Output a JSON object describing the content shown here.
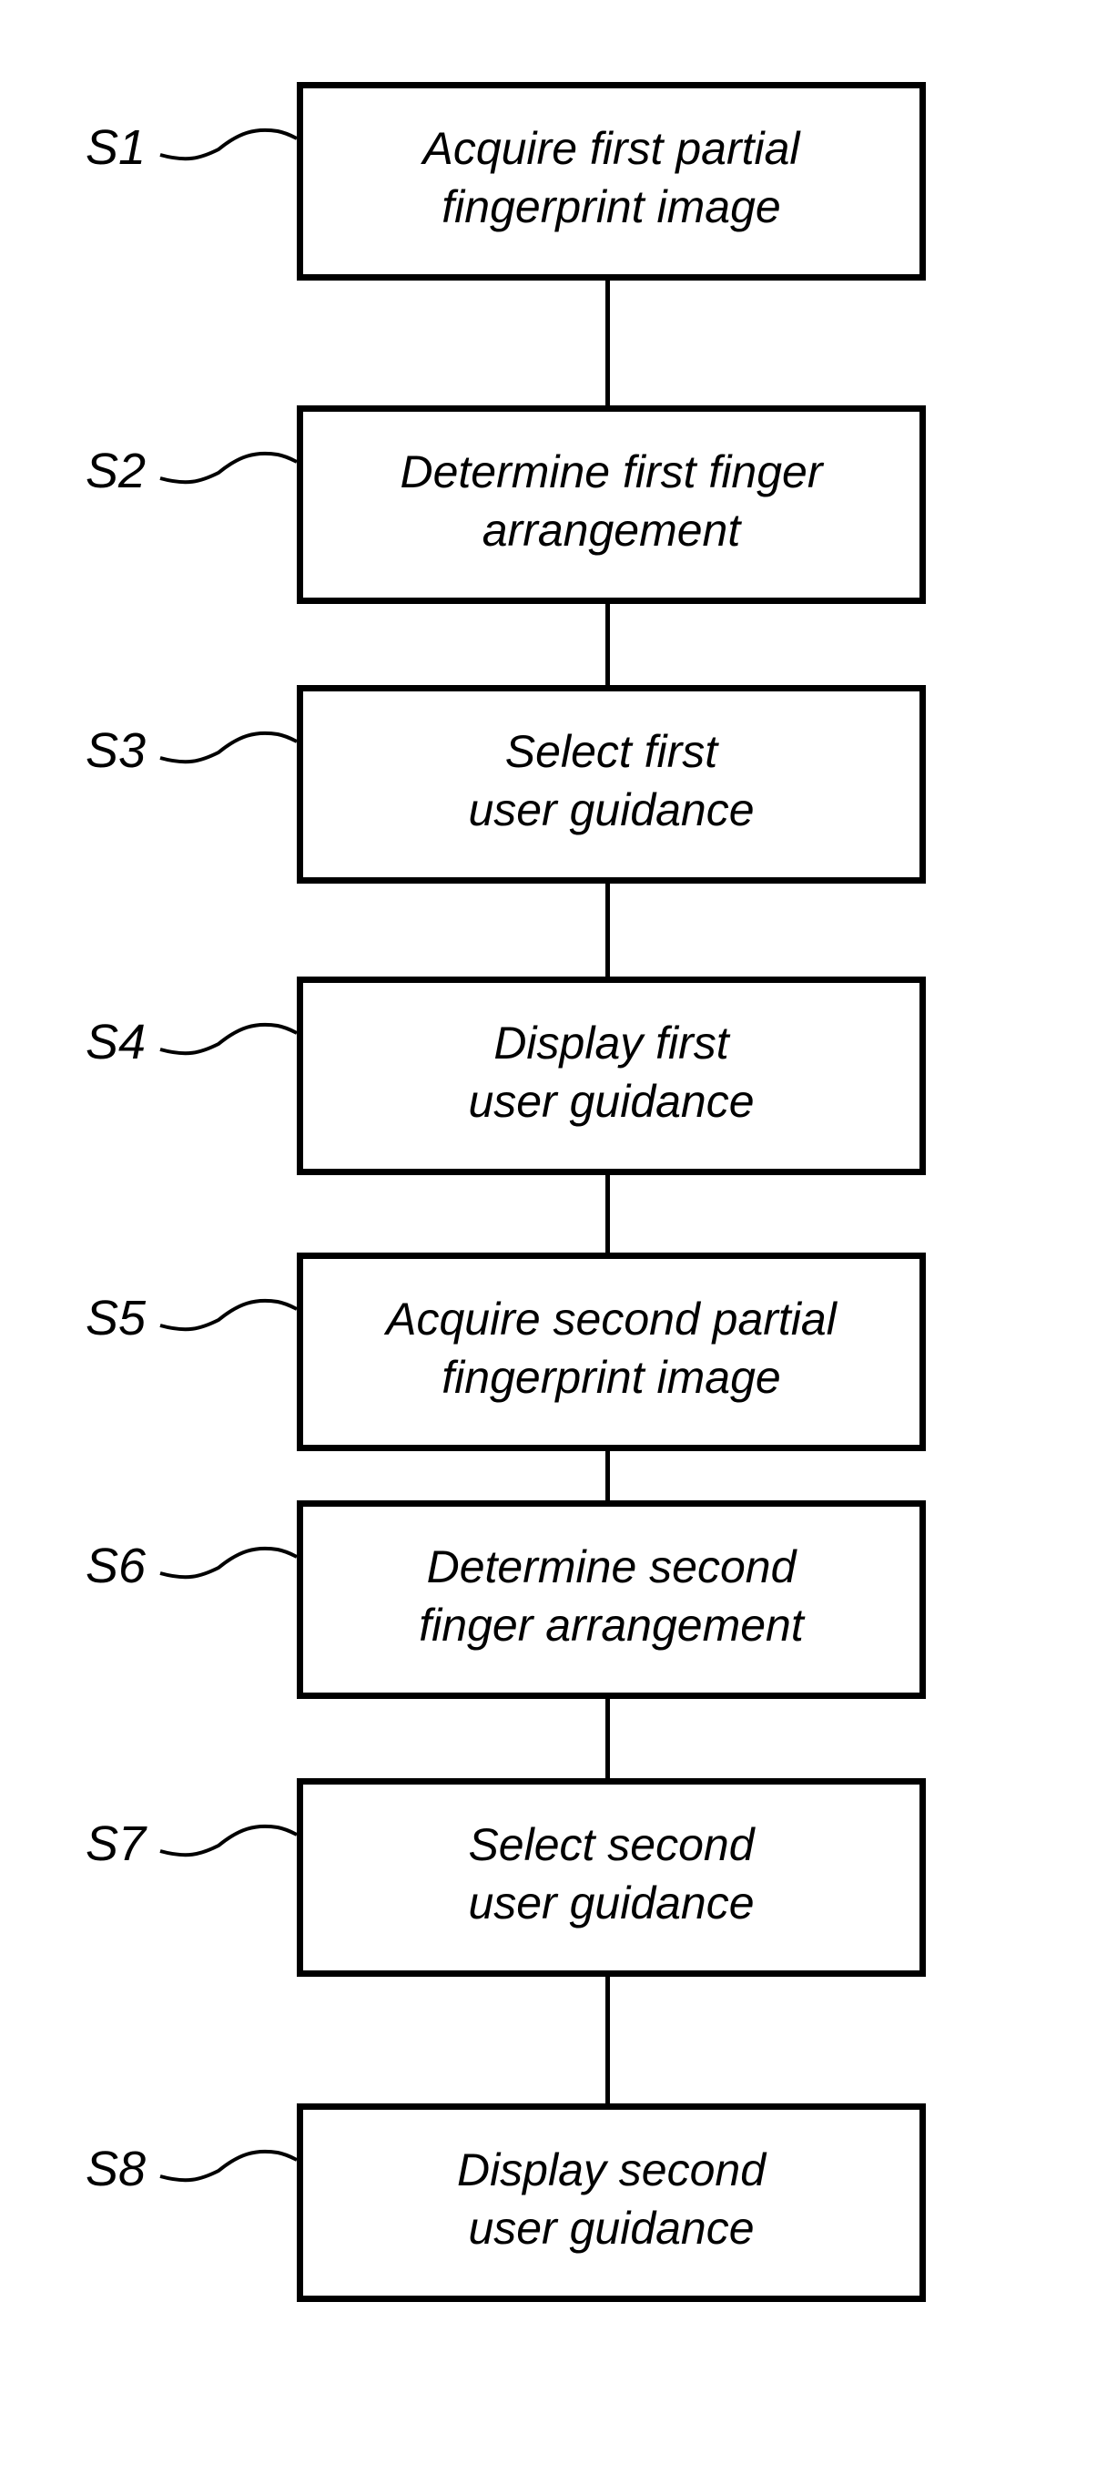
{
  "flowchart": {
    "steps": [
      {
        "label": "S1",
        "text": "Acquire first partial\nfingerprint image"
      },
      {
        "label": "S2",
        "text": "Determine first finger\narrangement"
      },
      {
        "label": "S3",
        "text": "Select first\nuser guidance"
      },
      {
        "label": "S4",
        "text": "Display first\nuser guidance"
      },
      {
        "label": "S5",
        "text": "Acquire second partial\nfingerprint image"
      },
      {
        "label": "S6",
        "text": "Determine second\nfinger arrangement"
      },
      {
        "label": "S7",
        "text": "Select second\nuser guidance"
      },
      {
        "label": "S8",
        "text": "Display second\nuser guidance"
      }
    ]
  }
}
